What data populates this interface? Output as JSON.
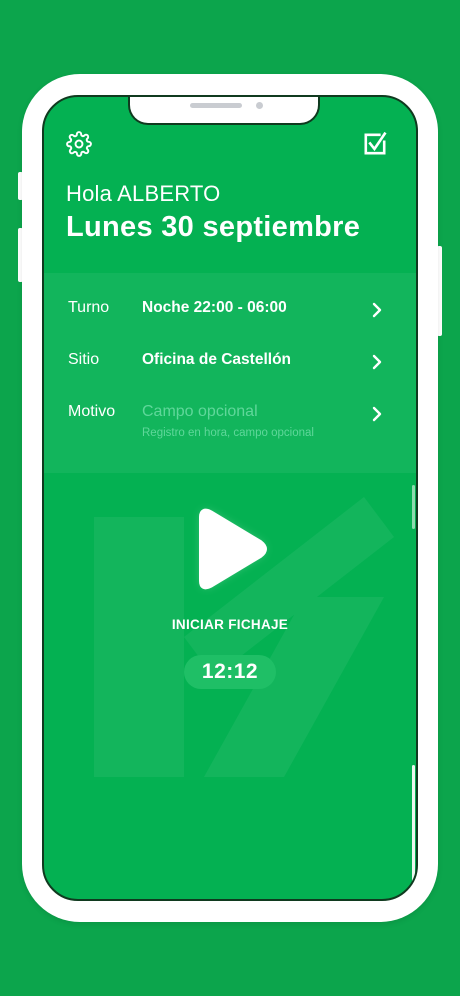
{
  "header": {
    "greeting": "Hola ALBERTO",
    "date": "Lunes 30 septiembre"
  },
  "icons": {
    "settings": "gear-icon",
    "edit": "edit-checkbox-icon"
  },
  "rows": [
    {
      "label": "Turno",
      "value": "Noche 22:00 - 06:00"
    },
    {
      "label": "Sitio",
      "value": "Oficina de Castellón"
    },
    {
      "label": "Motivo",
      "placeholder": "Campo opcional",
      "hint": "Registro en hora, campo opcional"
    }
  ],
  "action": {
    "label": "INICIAR FICHAJE",
    "time": "12:12"
  },
  "colors": {
    "background": "#0ca54c",
    "screen": "#04b152",
    "placeholder": "#5fd79a"
  }
}
